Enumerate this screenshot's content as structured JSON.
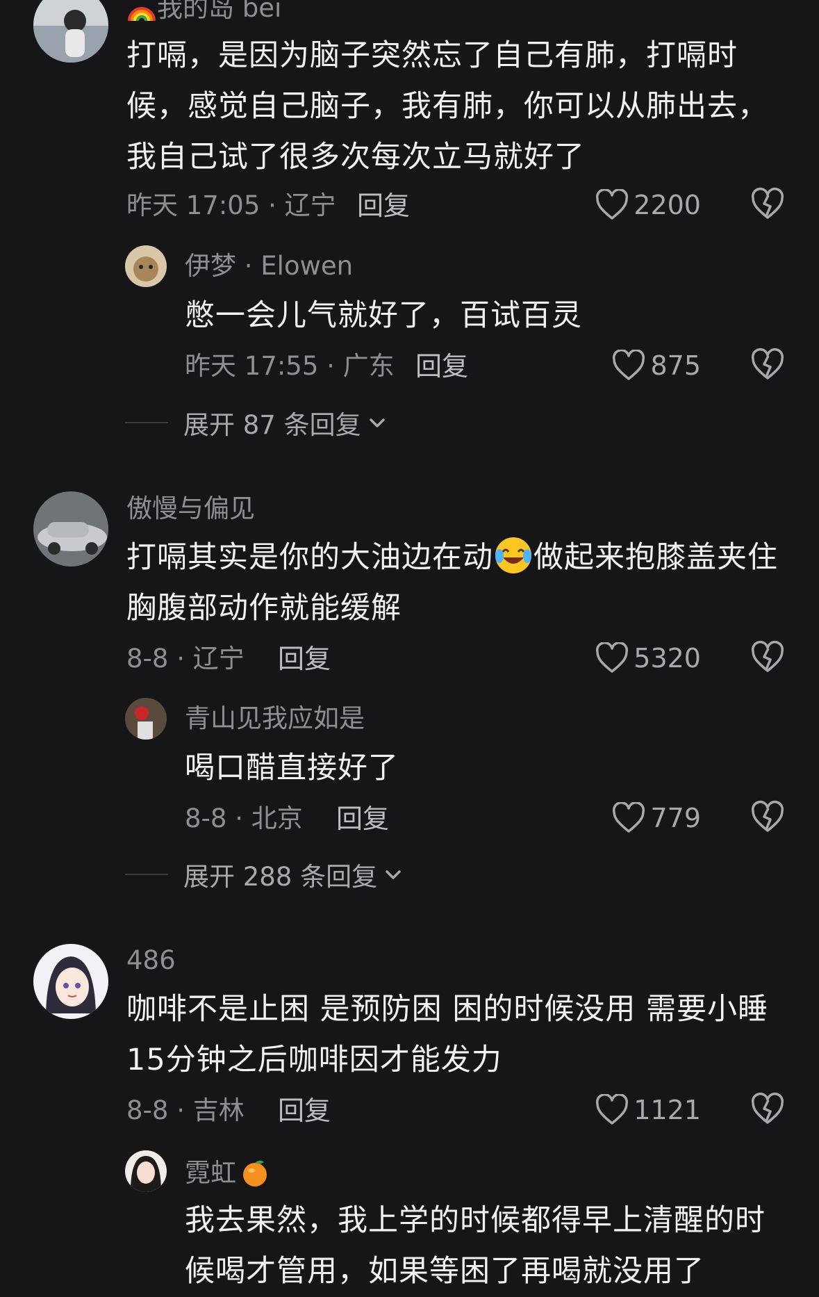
{
  "comments": [
    {
      "username": "我的岛 bei",
      "lines": [
        "打嗝，是因为脑子突然忘了自己有肺，打嗝时",
        "候，感觉自己脑子，我有肺，你可以从肺出去，",
        "我自己试了很多次每次立马就好了"
      ],
      "time_location": "昨天 17:05 · 辽宁",
      "reply_label": "回复",
      "likes": "2200",
      "reply": {
        "username": "伊梦 · Elowen",
        "text": "憋一会儿气就好了，百试百灵",
        "time_location": "昨天 17:55 · 广东",
        "reply_label": "回复",
        "likes": "875"
      },
      "expand_label": "展开 87 条回复"
    },
    {
      "username": "傲慢与偏见",
      "line1_a": "打嗝其实是你的大油边在动",
      "line1_b": "做起来抱膝盖夹住",
      "line2": "胸腹部动作就能缓解",
      "time_location": "8-8 · 辽宁",
      "reply_label": "回复",
      "likes": "5320",
      "reply": {
        "username": "青山见我应如是",
        "text": "喝口醋直接好了",
        "time_location": "8-8 · 北京",
        "reply_label": "回复",
        "likes": "779"
      },
      "expand_label": "展开 288 条回复"
    },
    {
      "username": "486",
      "lines": [
        "咖啡不是止困 是预防困 困的时候没用 需要小睡",
        "15分钟之后咖啡因才能发力"
      ],
      "time_location": "8-8 · 吉林",
      "reply_label": "回复",
      "likes": "1121",
      "reply": {
        "username": "霓虹",
        "lines": [
          "我去果然，我上学的时候都得早上清醒的时",
          "候喝才管用，如果等困了再喝就没用了"
        ]
      }
    }
  ],
  "icons": {
    "like": "heart-outline-icon",
    "dislike": "broken-heart-icon",
    "expand": "chevron-down-icon",
    "emoji_laugh": "laughing-tears-emoji",
    "emoji_orange": "orange-emoji",
    "emoji_rainbow": "rainbow-emoji"
  },
  "colors": {
    "background": "#161618",
    "text_primary": "#f2f2f2",
    "text_secondary": "#8e8e93"
  }
}
